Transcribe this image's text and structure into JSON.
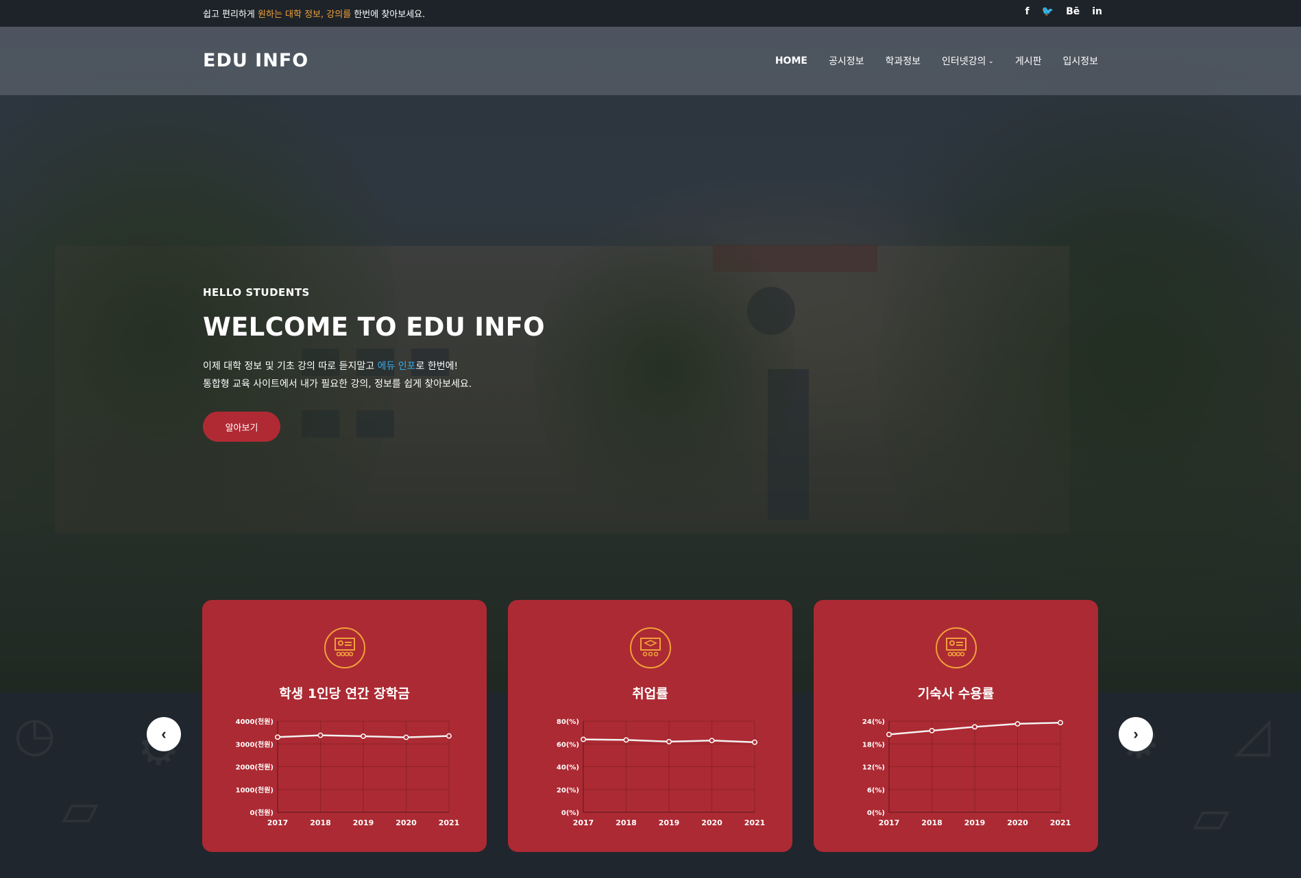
{
  "topbar": {
    "msg_pre": "쉽고 편리하게 ",
    "msg_highlight": "원하는 대학 정보, 강의를",
    "msg_post": " 한번에 찾아보세요.",
    "social": [
      "f",
      "🐦",
      "Bē",
      "in"
    ]
  },
  "header": {
    "logo": "EDU INFO",
    "nav": [
      {
        "label": "HOME"
      },
      {
        "label": "공시정보"
      },
      {
        "label": "학과정보"
      },
      {
        "label": "인터넷강의"
      },
      {
        "label": "게시판"
      },
      {
        "label": "입시정보"
      }
    ]
  },
  "hero": {
    "kicker": "HELLO STUDENTS",
    "title": "WELCOME TO EDU INFO",
    "desc1_pre": "이제 대학 정보 및 기초 강의 따로 듣지말고 ",
    "desc1_hl": "에듀 인포",
    "desc1_post": "로 한번에!",
    "desc2": "통합형 교육 사이트에서 내가 필요한 강의, 정보를 쉽게 찾아보세요.",
    "cta": "알아보기"
  },
  "colors": {
    "accent": "#b02a34",
    "highlight": "#f0a13a",
    "link": "#3aa9e8"
  },
  "cards": [
    {
      "title": "학생 1인당 연간 장학금",
      "icon": "lecture-icon"
    },
    {
      "title": "취업률",
      "icon": "graduation-icon"
    },
    {
      "title": "기숙사 수용률",
      "icon": "lecture-icon"
    }
  ],
  "chart_data": [
    {
      "type": "line",
      "title": "학생 1인당 연간 장학금",
      "categories": [
        "2017",
        "2018",
        "2019",
        "2020",
        "2021"
      ],
      "values": [
        3300,
        3380,
        3340,
        3290,
        3350
      ],
      "ylim": [
        0,
        4000
      ],
      "yticks": [
        "0(천원)",
        "1000(천원)",
        "2000(천원)",
        "3000(천원)",
        "4000(천원)"
      ],
      "ytick_values": [
        0,
        1000,
        2000,
        3000,
        4000
      ]
    },
    {
      "type": "line",
      "title": "취업률",
      "categories": [
        "2017",
        "2018",
        "2019",
        "2020",
        "2021"
      ],
      "values": [
        64,
        63.5,
        62,
        63,
        61.5
      ],
      "ylim": [
        0,
        80
      ],
      "yticks": [
        "0(%)",
        "20(%)",
        "40(%)",
        "60(%)",
        "80(%)"
      ],
      "ytick_values": [
        0,
        20,
        40,
        60,
        80
      ]
    },
    {
      "type": "line",
      "title": "기숙사 수용률",
      "categories": [
        "2017",
        "2018",
        "2019",
        "2020",
        "2021"
      ],
      "values": [
        20.5,
        21.5,
        22.5,
        23.3,
        23.6
      ],
      "ylim": [
        0,
        24
      ],
      "yticks": [
        "0(%)",
        "6(%)",
        "12(%)",
        "18(%)",
        "24(%)"
      ],
      "ytick_values": [
        0,
        6,
        12,
        18,
        24
      ]
    }
  ]
}
